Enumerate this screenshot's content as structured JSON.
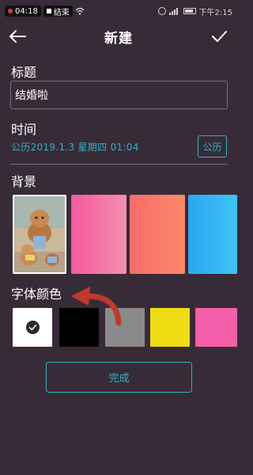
{
  "status_bar": {
    "recording_time": "04:18",
    "stop_label": "结束",
    "clock": "下午2:15"
  },
  "header": {
    "title": "新建"
  },
  "form": {
    "title_label": "标题",
    "title_value": "结婚啦",
    "time_label": "时间",
    "date_value": "公历2019.1.3  星期四 01:04",
    "calendar_button": "公历",
    "background_label": "背景",
    "font_color_label": "字体颜色",
    "finish_button": "完成"
  },
  "background_swatches": [
    {
      "name": "photo"
    },
    {
      "name": "pink",
      "color": "#f35a9e"
    },
    {
      "name": "coral",
      "color": "#f96b6b"
    },
    {
      "name": "blue",
      "color": "#2aa6f0"
    }
  ],
  "font_colors": [
    {
      "color": "#ffffff",
      "selected": true
    },
    {
      "color": "#000000"
    },
    {
      "color": "#8a8a8a"
    },
    {
      "color": "#f0dc12"
    },
    {
      "color": "#f55ea8"
    }
  ],
  "theme": {
    "background": "#382b38",
    "accent": "#2eb4c4",
    "annotation_arrow": "#c0392b"
  }
}
